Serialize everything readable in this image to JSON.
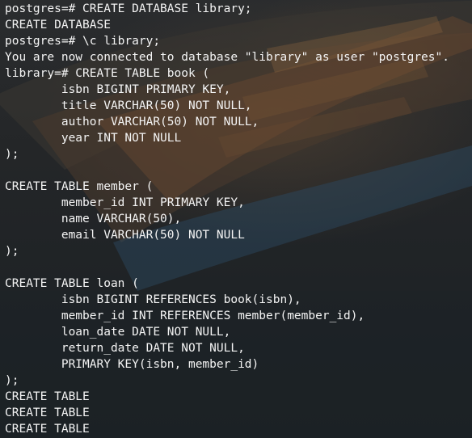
{
  "terminal": {
    "lines": [
      "postgres=# CREATE DATABASE library;",
      "CREATE DATABASE",
      "postgres=# \\c library;",
      "You are now connected to database \"library\" as user \"postgres\".",
      "library=# CREATE TABLE book (",
      "        isbn BIGINT PRIMARY KEY,",
      "        title VARCHAR(50) NOT NULL,",
      "        author VARCHAR(50) NOT NULL,",
      "        year INT NOT NULL",
      ");",
      "",
      "CREATE TABLE member (",
      "        member_id INT PRIMARY KEY,",
      "        name VARCHAR(50),",
      "        email VARCHAR(50) NOT NULL",
      ");",
      "",
      "CREATE TABLE loan (",
      "        isbn BIGINT REFERENCES book(isbn),",
      "        member_id INT REFERENCES member(member_id),",
      "        loan_date DATE NOT NULL,",
      "        return_date DATE NOT NULL,",
      "        PRIMARY KEY(isbn, member_id)",
      ");",
      "CREATE TABLE",
      "CREATE TABLE",
      "CREATE TABLE"
    ]
  },
  "background": {
    "description_icon": "boat-wallpaper",
    "colors": {
      "base": "#1f2224",
      "wood": "#6b4a30",
      "hull_blue": "#2c4b63",
      "text": "#f4f4f4"
    }
  }
}
